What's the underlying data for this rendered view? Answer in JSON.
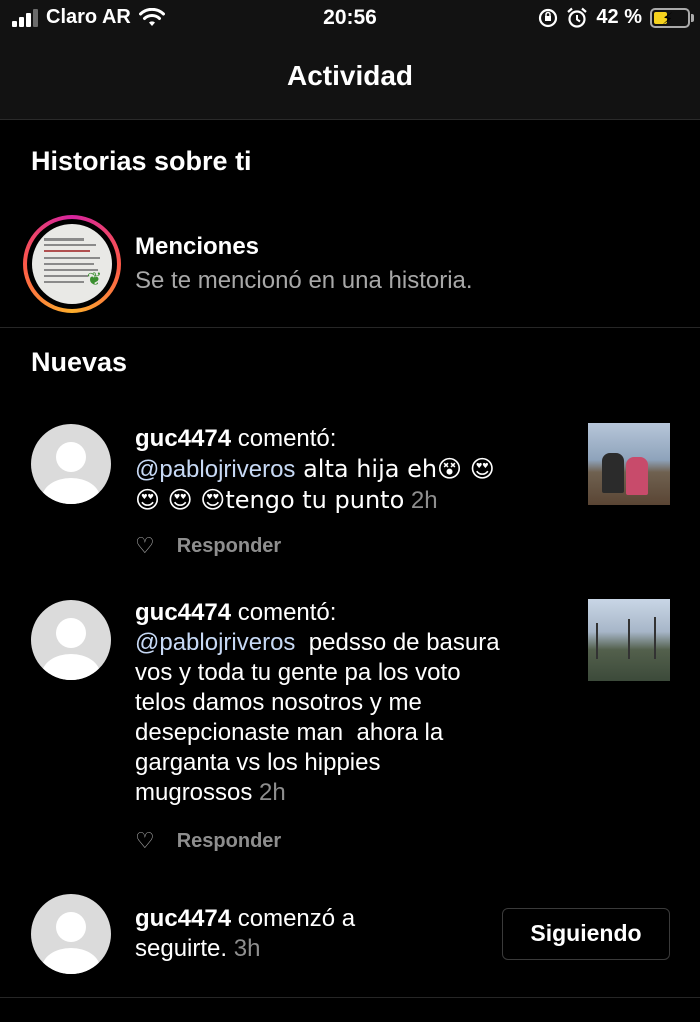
{
  "status_bar": {
    "carrier": "Claro AR",
    "time": "20:56",
    "battery_percent": "42 %",
    "battery_level": 0.42,
    "icons": [
      "signal-icon",
      "wifi-icon",
      "orientation-lock-icon",
      "alarm-icon",
      "battery-charging-icon"
    ]
  },
  "header": {
    "title": "Actividad"
  },
  "stories_section": {
    "title": "Historias sobre ti",
    "mentions_title": "Menciones",
    "mentions_subtitle": "Se te mencionó en una historia."
  },
  "new_section": {
    "title": "Nuevas",
    "items": [
      {
        "username": "guc4474",
        "action": " comentó:",
        "mention": "@pablojriveros",
        "text_line1_rest": " alta hija eh😵 😍",
        "text_line2": "😍 😍 😍tengo tu punto",
        "time": "2h",
        "reply_label": "Responder"
      },
      {
        "username": "guc4474",
        "action": " comentó:",
        "mention": "@pablojriveros",
        "text_line1_rest": "  pedsso de basura",
        "text_lines": [
          "vos y toda tu gente pa los voto",
          "telos damos nosotros y me",
          "desepcionaste man  ahora la",
          "garganta vs los hippies"
        ],
        "text_last": "mugrossos",
        "time": "2h",
        "reply_label": "Responder"
      },
      {
        "username": "guc4474",
        "action": " comenzó a",
        "text_line2": "seguirte.",
        "time": "3h",
        "button_label": "Siguiendo"
      }
    ]
  },
  "colors": {
    "background": "#000000",
    "secondary_text": "#a8a8a8",
    "mention": "#c7d9f5"
  }
}
